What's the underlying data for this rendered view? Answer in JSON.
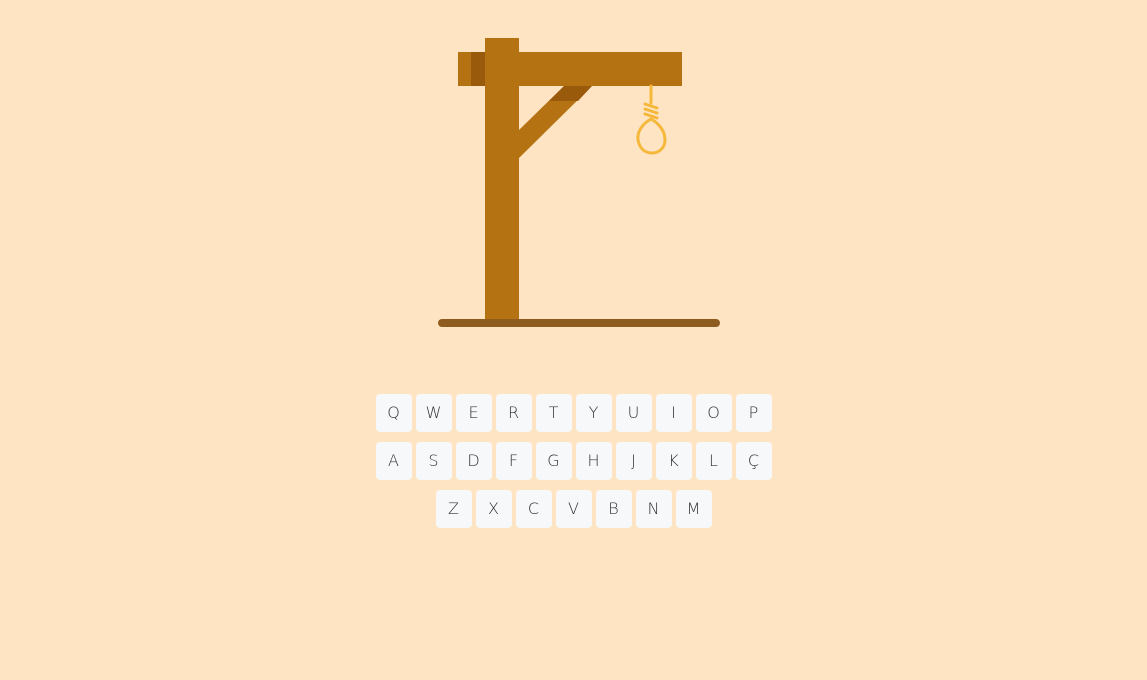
{
  "colors": {
    "background": "#fee4c3",
    "wood": "#b47212",
    "wood_shadow": "#995a0c",
    "base": "#8f5c1f",
    "rope": "#f5b83b",
    "key_bg": "#f7f8fa",
    "key_text": "#333333"
  },
  "gallows": {
    "icon": "gallows-with-noose"
  },
  "keyboard": {
    "rows": [
      [
        "Q",
        "W",
        "E",
        "R",
        "T",
        "Y",
        "U",
        "I",
        "O",
        "P"
      ],
      [
        "A",
        "S",
        "D",
        "F",
        "G",
        "H",
        "J",
        "K",
        "L",
        "Ç"
      ],
      [
        "Z",
        "X",
        "C",
        "V",
        "B",
        "N",
        "M"
      ]
    ]
  }
}
